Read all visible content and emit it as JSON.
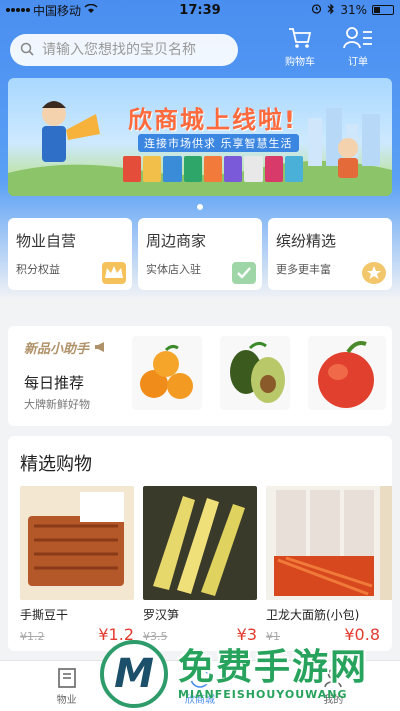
{
  "status_bar": {
    "carrier": "中国移动",
    "time": "17:39",
    "battery": "31%"
  },
  "header": {
    "search_placeholder": "请输入您想找的宝贝名称",
    "cart_label": "购物车",
    "orders_label": "订单"
  },
  "banner": {
    "title": "欣商城上线啦!",
    "subtitle": "连接市场供求 乐享智慧生活"
  },
  "categories": [
    {
      "title": "物业自营",
      "subtitle": "积分权益",
      "icon": "vip-crown-icon",
      "color": "#f5c15a"
    },
    {
      "title": "周边商家",
      "subtitle": "实体店入驻",
      "icon": "check-box-icon",
      "color": "#9fd6a8"
    },
    {
      "title": "缤纷精选",
      "subtitle": "更多更丰富",
      "icon": "medal-icon",
      "color": "#f2c66a"
    }
  ],
  "new_products": {
    "badge": "新品小助手",
    "title": "每日推荐",
    "subtitle": "大牌新鲜好物"
  },
  "featured": {
    "title": "精选购物",
    "products": [
      {
        "name": "手撕豆干",
        "price": "¥1.2",
        "old_price": "¥1.2"
      },
      {
        "name": "罗汉笋",
        "price": "¥3",
        "old_price": "¥3.5"
      },
      {
        "name": "卫龙大面筋(小包)",
        "price": "¥0.8",
        "old_price": "¥1"
      }
    ]
  },
  "tabbar": {
    "items": [
      "物业",
      "欣商城",
      "我的"
    ]
  },
  "watermark": {
    "title": "免费手游网",
    "url": "MIANFEISHOUYOUWANG",
    "logo_letter": "M"
  },
  "colors": {
    "primary_blue": "#4a8ef0",
    "price_red": "#e23b2e",
    "watermark_green": "#27a35d"
  }
}
